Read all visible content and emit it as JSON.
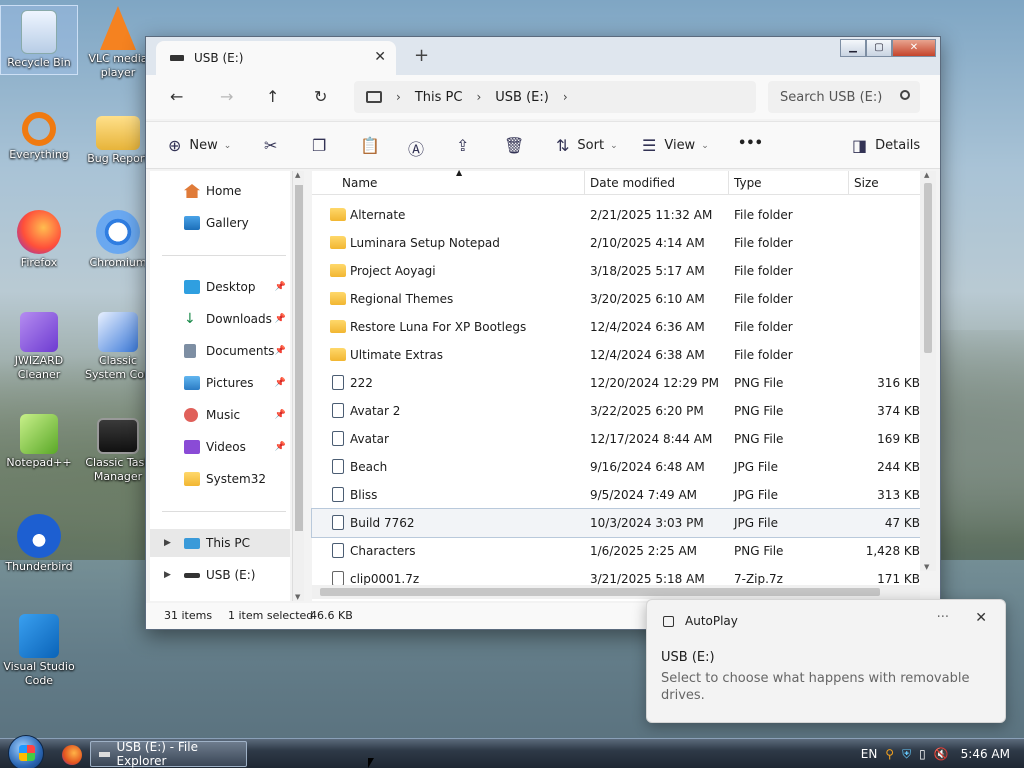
{
  "desktop": {
    "icons": [
      {
        "label": "Recycle Bin"
      },
      {
        "label": "VLC media player"
      },
      {
        "label": "Everything"
      },
      {
        "label": "Bug Report"
      },
      {
        "label": "Firefox"
      },
      {
        "label": "Chromium"
      },
      {
        "label": "JWIZARD Cleaner"
      },
      {
        "label": "Classic System Con"
      },
      {
        "label": "Notepad++"
      },
      {
        "label": "Classic Task Manager"
      },
      {
        "label": "Thunderbird"
      },
      {
        "label": "Visual Studio Code"
      }
    ]
  },
  "window": {
    "tab_title": "USB (E:)",
    "address": {
      "segments": [
        "This PC",
        "USB (E:)"
      ]
    },
    "search_placeholder": "Search USB (E:)",
    "toolbar": {
      "new_label": "New",
      "sort_label": "Sort",
      "view_label": "View",
      "more_label": "•••",
      "details_label": "Details"
    },
    "sidebar": {
      "items": [
        {
          "label": "Home"
        },
        {
          "label": "Gallery"
        },
        {
          "label": "Desktop"
        },
        {
          "label": "Downloads"
        },
        {
          "label": "Documents"
        },
        {
          "label": "Pictures"
        },
        {
          "label": "Music"
        },
        {
          "label": "Videos"
        },
        {
          "label": "System32"
        },
        {
          "label": "This PC"
        },
        {
          "label": "USB (E:)"
        }
      ]
    },
    "columns": {
      "name": "Name",
      "date": "Date modified",
      "type": "Type",
      "size": "Size"
    },
    "files": [
      {
        "name": "Alternate",
        "date": "2/21/2025 11:32 AM",
        "type": "File folder",
        "size": ""
      },
      {
        "name": "Luminara Setup Notepad",
        "date": "2/10/2025 4:14 AM",
        "type": "File folder",
        "size": ""
      },
      {
        "name": "Project Aoyagi",
        "date": "3/18/2025 5:17 AM",
        "type": "File folder",
        "size": ""
      },
      {
        "name": "Regional Themes",
        "date": "3/20/2025 6:10 AM",
        "type": "File folder",
        "size": ""
      },
      {
        "name": "Restore Luna For XP Bootlegs",
        "date": "12/4/2024 6:36 AM",
        "type": "File folder",
        "size": ""
      },
      {
        "name": "Ultimate Extras",
        "date": "12/4/2024 6:38 AM",
        "type": "File folder",
        "size": ""
      },
      {
        "name": "222",
        "date": "12/20/2024 12:29 PM",
        "type": "PNG File",
        "size": "316 KB"
      },
      {
        "name": "Avatar 2",
        "date": "3/22/2025 6:20 PM",
        "type": "PNG File",
        "size": "374 KB"
      },
      {
        "name": "Avatar",
        "date": "12/17/2024 8:44 AM",
        "type": "PNG File",
        "size": "169 KB"
      },
      {
        "name": "Beach",
        "date": "9/16/2024 6:48 AM",
        "type": "JPG File",
        "size": "244 KB"
      },
      {
        "name": "Bliss",
        "date": "9/5/2024 7:49 AM",
        "type": "JPG File",
        "size": "313 KB"
      },
      {
        "name": "Build 7762",
        "date": "10/3/2024 3:03 PM",
        "type": "JPG File",
        "size": "47 KB"
      },
      {
        "name": "Characters",
        "date": "1/6/2025 2:25 AM",
        "type": "PNG File",
        "size": "1,428 KB"
      },
      {
        "name": "clip0001.7z",
        "date": "3/21/2025 5:18 AM",
        "type": "7-Zip.7z",
        "size": "171 KB"
      }
    ],
    "status": {
      "items": "31 items",
      "selected": "1 item selected",
      "size": "46.6 KB"
    }
  },
  "toast": {
    "app": "AutoPlay",
    "title": "USB (E:)",
    "message": "Select to choose what happens with removable drives.",
    "more": "···"
  },
  "taskbar": {
    "task_label": "USB (E:) - File Explorer",
    "lang": "EN",
    "time": "5:46 AM"
  }
}
